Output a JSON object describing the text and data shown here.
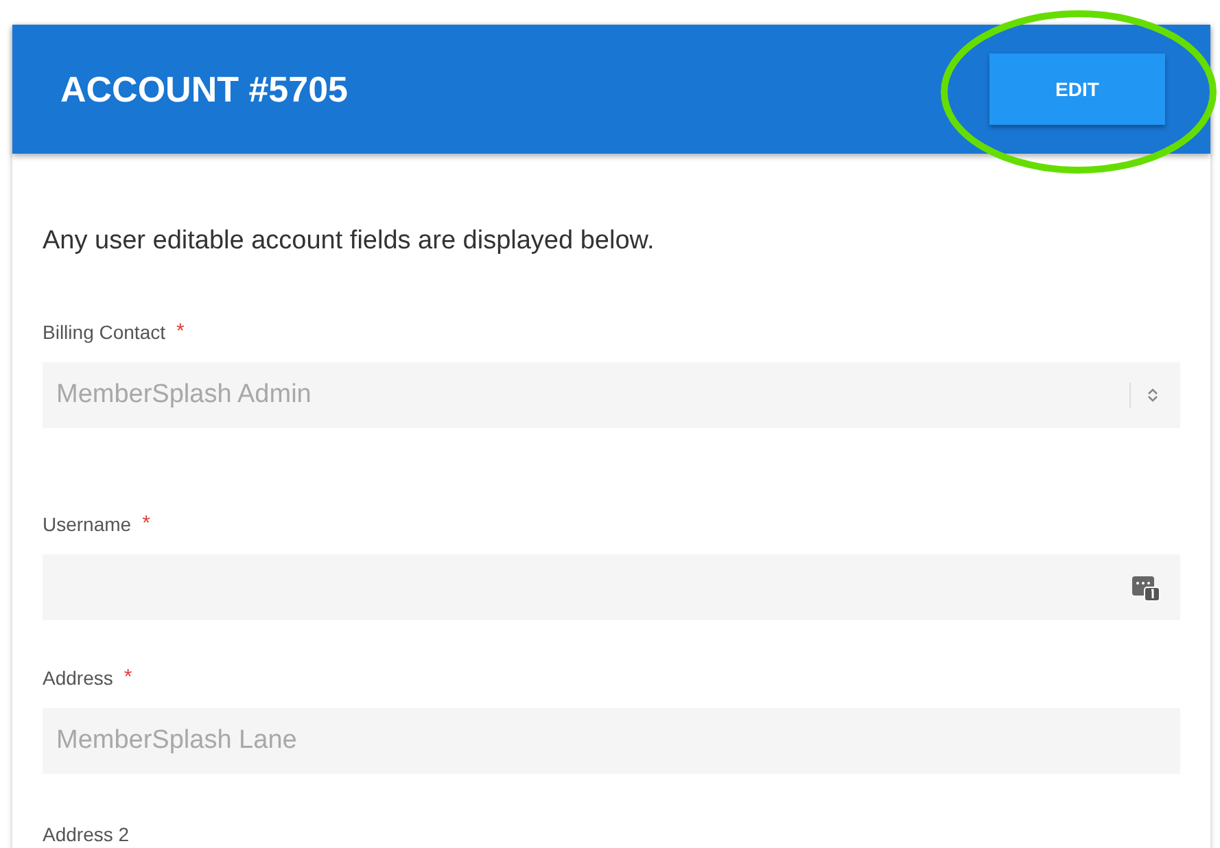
{
  "header": {
    "title": "ACCOUNT #5705",
    "button": "EDIT"
  },
  "annotation": {
    "kind": "ellipse",
    "color": "#66dd00"
  },
  "intro": "Any user editable account fields are displayed below.",
  "fields": [
    {
      "kind": "select",
      "label": "Billing Contact",
      "required_mark": "*",
      "value": "MemberSplash Admin"
    },
    {
      "kind": "text",
      "label": "Username",
      "required_mark": "*",
      "autofill_icon": true
    },
    {
      "kind": "text",
      "label": "Address",
      "required_mark": "*",
      "value": "MemberSplash Lane"
    },
    {
      "kind": "label",
      "label": "Address 2"
    }
  ]
}
